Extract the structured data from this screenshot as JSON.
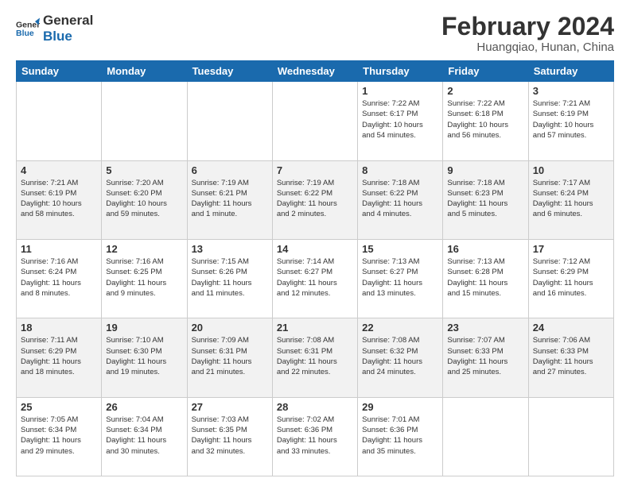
{
  "logo": {
    "line1": "General",
    "line2": "Blue"
  },
  "title": "February 2024",
  "subtitle": "Huangqiao, Hunan, China",
  "weekdays": [
    "Sunday",
    "Monday",
    "Tuesday",
    "Wednesday",
    "Thursday",
    "Friday",
    "Saturday"
  ],
  "weeks": [
    [
      {
        "day": "",
        "info": ""
      },
      {
        "day": "",
        "info": ""
      },
      {
        "day": "",
        "info": ""
      },
      {
        "day": "",
        "info": ""
      },
      {
        "day": "1",
        "info": "Sunrise: 7:22 AM\nSunset: 6:17 PM\nDaylight: 10 hours\nand 54 minutes."
      },
      {
        "day": "2",
        "info": "Sunrise: 7:22 AM\nSunset: 6:18 PM\nDaylight: 10 hours\nand 56 minutes."
      },
      {
        "day": "3",
        "info": "Sunrise: 7:21 AM\nSunset: 6:19 PM\nDaylight: 10 hours\nand 57 minutes."
      }
    ],
    [
      {
        "day": "4",
        "info": "Sunrise: 7:21 AM\nSunset: 6:19 PM\nDaylight: 10 hours\nand 58 minutes."
      },
      {
        "day": "5",
        "info": "Sunrise: 7:20 AM\nSunset: 6:20 PM\nDaylight: 10 hours\nand 59 minutes."
      },
      {
        "day": "6",
        "info": "Sunrise: 7:19 AM\nSunset: 6:21 PM\nDaylight: 11 hours\nand 1 minute."
      },
      {
        "day": "7",
        "info": "Sunrise: 7:19 AM\nSunset: 6:22 PM\nDaylight: 11 hours\nand 2 minutes."
      },
      {
        "day": "8",
        "info": "Sunrise: 7:18 AM\nSunset: 6:22 PM\nDaylight: 11 hours\nand 4 minutes."
      },
      {
        "day": "9",
        "info": "Sunrise: 7:18 AM\nSunset: 6:23 PM\nDaylight: 11 hours\nand 5 minutes."
      },
      {
        "day": "10",
        "info": "Sunrise: 7:17 AM\nSunset: 6:24 PM\nDaylight: 11 hours\nand 6 minutes."
      }
    ],
    [
      {
        "day": "11",
        "info": "Sunrise: 7:16 AM\nSunset: 6:24 PM\nDaylight: 11 hours\nand 8 minutes."
      },
      {
        "day": "12",
        "info": "Sunrise: 7:16 AM\nSunset: 6:25 PM\nDaylight: 11 hours\nand 9 minutes."
      },
      {
        "day": "13",
        "info": "Sunrise: 7:15 AM\nSunset: 6:26 PM\nDaylight: 11 hours\nand 11 minutes."
      },
      {
        "day": "14",
        "info": "Sunrise: 7:14 AM\nSunset: 6:27 PM\nDaylight: 11 hours\nand 12 minutes."
      },
      {
        "day": "15",
        "info": "Sunrise: 7:13 AM\nSunset: 6:27 PM\nDaylight: 11 hours\nand 13 minutes."
      },
      {
        "day": "16",
        "info": "Sunrise: 7:13 AM\nSunset: 6:28 PM\nDaylight: 11 hours\nand 15 minutes."
      },
      {
        "day": "17",
        "info": "Sunrise: 7:12 AM\nSunset: 6:29 PM\nDaylight: 11 hours\nand 16 minutes."
      }
    ],
    [
      {
        "day": "18",
        "info": "Sunrise: 7:11 AM\nSunset: 6:29 PM\nDaylight: 11 hours\nand 18 minutes."
      },
      {
        "day": "19",
        "info": "Sunrise: 7:10 AM\nSunset: 6:30 PM\nDaylight: 11 hours\nand 19 minutes."
      },
      {
        "day": "20",
        "info": "Sunrise: 7:09 AM\nSunset: 6:31 PM\nDaylight: 11 hours\nand 21 minutes."
      },
      {
        "day": "21",
        "info": "Sunrise: 7:08 AM\nSunset: 6:31 PM\nDaylight: 11 hours\nand 22 minutes."
      },
      {
        "day": "22",
        "info": "Sunrise: 7:08 AM\nSunset: 6:32 PM\nDaylight: 11 hours\nand 24 minutes."
      },
      {
        "day": "23",
        "info": "Sunrise: 7:07 AM\nSunset: 6:33 PM\nDaylight: 11 hours\nand 25 minutes."
      },
      {
        "day": "24",
        "info": "Sunrise: 7:06 AM\nSunset: 6:33 PM\nDaylight: 11 hours\nand 27 minutes."
      }
    ],
    [
      {
        "day": "25",
        "info": "Sunrise: 7:05 AM\nSunset: 6:34 PM\nDaylight: 11 hours\nand 29 minutes."
      },
      {
        "day": "26",
        "info": "Sunrise: 7:04 AM\nSunset: 6:34 PM\nDaylight: 11 hours\nand 30 minutes."
      },
      {
        "day": "27",
        "info": "Sunrise: 7:03 AM\nSunset: 6:35 PM\nDaylight: 11 hours\nand 32 minutes."
      },
      {
        "day": "28",
        "info": "Sunrise: 7:02 AM\nSunset: 6:36 PM\nDaylight: 11 hours\nand 33 minutes."
      },
      {
        "day": "29",
        "info": "Sunrise: 7:01 AM\nSunset: 6:36 PM\nDaylight: 11 hours\nand 35 minutes."
      },
      {
        "day": "",
        "info": ""
      },
      {
        "day": "",
        "info": ""
      }
    ]
  ]
}
